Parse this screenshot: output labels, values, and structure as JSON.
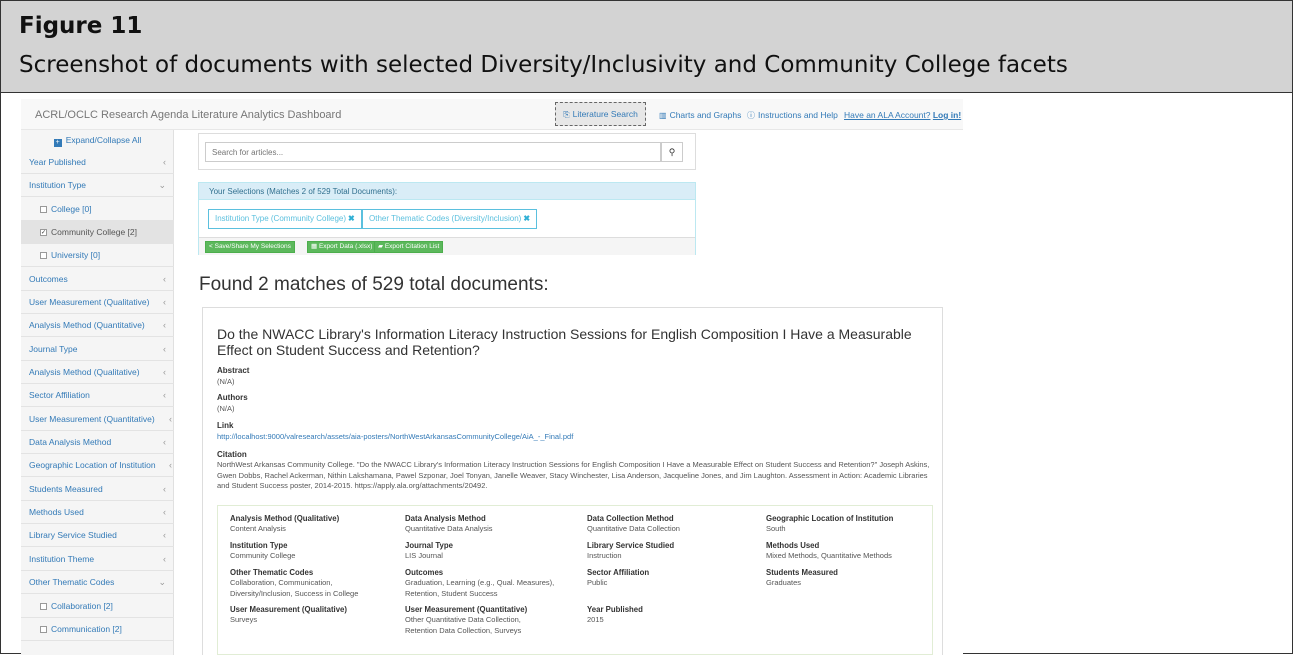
{
  "figure": {
    "label": "Figure 11",
    "caption": "Screenshot of documents with selected Diversity/Inclusivity and Community College facets"
  },
  "nav": {
    "brand": "ACRL/OCLC Research Agenda Literature Analytics Dashboard",
    "literature_search": "Literature Search",
    "charts": "Charts and Graphs",
    "help": "Instructions and Help",
    "account": "Have an ALA Account?",
    "login": "Log in!"
  },
  "sidebar": {
    "expand_all": "Expand/Collapse All",
    "items": [
      {
        "label": "Year Published"
      },
      {
        "label": "Institution Type"
      },
      {
        "label": "College [0]"
      },
      {
        "label": "Community College [2]"
      },
      {
        "label": "University [0]"
      },
      {
        "label": "Outcomes"
      },
      {
        "label": "User Measurement (Qualitative)"
      },
      {
        "label": "Analysis Method (Quantitative)"
      },
      {
        "label": "Journal Type"
      },
      {
        "label": "Analysis Method (Qualitative)"
      },
      {
        "label": "Sector Affiliation"
      },
      {
        "label": "User Measurement (Quantitative)"
      },
      {
        "label": "Data Analysis Method"
      },
      {
        "label": "Geographic Location of Institution"
      },
      {
        "label": "Students Measured"
      },
      {
        "label": "Methods Used"
      },
      {
        "label": "Library Service Studied"
      },
      {
        "label": "Institution Theme"
      },
      {
        "label": "Other Thematic Codes"
      },
      {
        "label": "Collaboration [2]"
      },
      {
        "label": "Communication [2]"
      }
    ]
  },
  "search": {
    "placeholder": "Search for articles..."
  },
  "selections": {
    "heading": "Your Selections (Matches 2 of 529 Total Documents):",
    "chips": [
      "Institution Type (Community College)",
      "Other Thematic Codes (Diversity/Inclusion)"
    ],
    "buttons": [
      "Save/Share My Selections",
      "Export Data (.xlsx)",
      "Export Citation List"
    ]
  },
  "results": {
    "found_text": "Found 2 matches of 529 total documents:"
  },
  "document": {
    "title": "Do the NWACC Library's Information Literacy Instruction Sessions for English Composition I Have a Measurable Effect on Student Success and Retention?",
    "abstract_label": "Abstract",
    "abstract": "(N/A)",
    "authors_label": "Authors",
    "authors": "(N/A)",
    "link_label": "Link",
    "link": "http://localhost:9000/valresearch/assets/aia-posters/NorthWestArkansasCommunityCollege/AiA_-_Final.pdf",
    "citation_label": "Citation",
    "citation": "NorthWest Arkansas Community College. \"Do the NWACC Library's Information Literacy Instruction Sessions for English Composition I Have a Measurable Effect on Student Success and Retention?\" Joseph Askins, Gwen Dobbs, Rachel Ackerman, Nithin Lakshamana, Pawel Szponar, Joel Tonyan, Janelle Weaver, Stacy Winchester, Lisa Anderson, Jacqueline Jones, and Jim Laughton. Assessment in Action: Academic Libraries and Student Success poster, 2014-2015. https://apply.ala.org/attachments/20492.",
    "meta": [
      {
        "label": "Analysis Method (Qualitative)",
        "value": "Content Analysis"
      },
      {
        "label": "Data Analysis Method",
        "value": "Quantitative Data Analysis"
      },
      {
        "label": "Data Collection Method",
        "value": "Quantitative Data Collection"
      },
      {
        "label": "Geographic Location of Institution",
        "value": "South"
      },
      {
        "label": "Institution Type",
        "value": "Community College"
      },
      {
        "label": "Journal Type",
        "value": "LIS Journal"
      },
      {
        "label": "Library Service Studied",
        "value": "Instruction"
      },
      {
        "label": "Methods Used",
        "value": "Mixed Methods, Quantitative Methods"
      },
      {
        "label": "Other Thematic Codes",
        "value": "Collaboration, Communication, Diversity/Inclusion, Success in College"
      },
      {
        "label": "Outcomes",
        "value": "Graduation, Learning (e.g., Qual. Measures), Retention, Student Success"
      },
      {
        "label": "Sector Affiliation",
        "value": "Public"
      },
      {
        "label": "Students Measured",
        "value": "Graduates"
      },
      {
        "label": "User Measurement (Qualitative)",
        "value": "Surveys"
      },
      {
        "label": "User Measurement (Quantitative)",
        "value": "Other Quantitative Data Collection, Retention Data Collection, Surveys"
      },
      {
        "label": "Year Published",
        "value": "2015"
      }
    ]
  }
}
